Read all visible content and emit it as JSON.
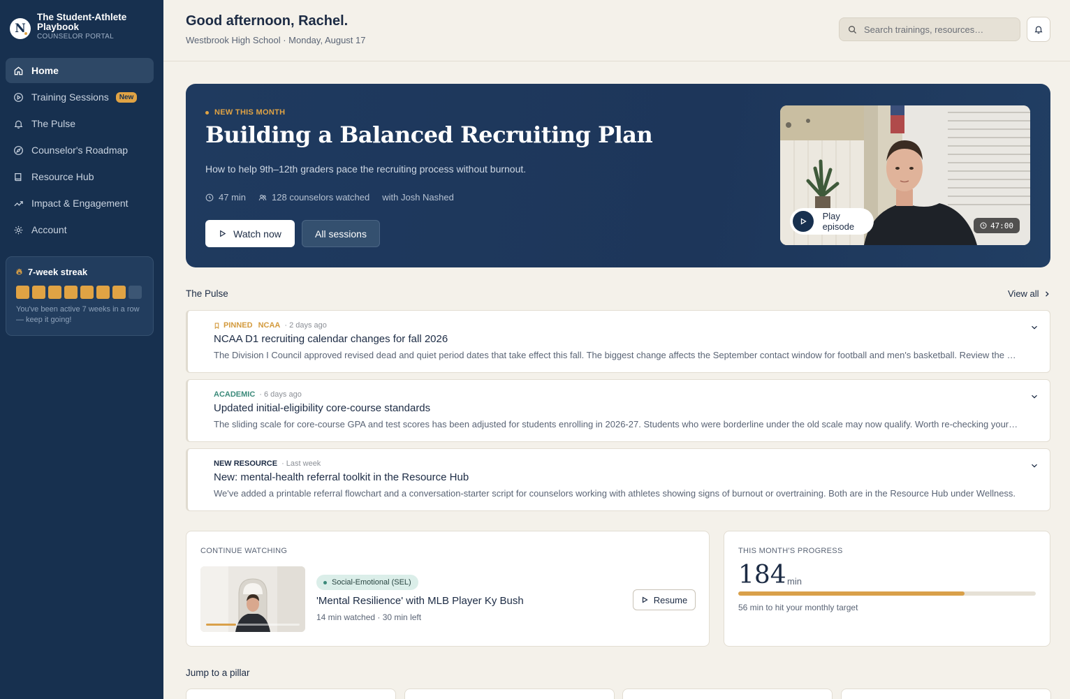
{
  "brand": {
    "logo_letter": "N",
    "title": "The Student-Athlete Playbook",
    "subtitle": "COUNSELOR PORTAL"
  },
  "nav": {
    "items": [
      {
        "label": "Home",
        "icon": "home-icon"
      },
      {
        "label": "Training Sessions",
        "icon": "play-circle-icon",
        "badge": "New"
      },
      {
        "label": "The Pulse",
        "icon": "bell-icon"
      },
      {
        "label": "Counselor's Roadmap",
        "icon": "compass-icon"
      },
      {
        "label": "Resource Hub",
        "icon": "book-icon"
      },
      {
        "label": "Impact & Engagement",
        "icon": "trending-up-icon"
      },
      {
        "label": "Account",
        "icon": "gear-icon"
      }
    ],
    "active": "Home"
  },
  "streak": {
    "title": "7-week streak",
    "weeks_active": 7,
    "weeks_total": 8,
    "message": "You've been active 7 weeks in a row — keep it going!"
  },
  "header": {
    "greeting": "Good afternoon, Rachel.",
    "subtitle": "Westbrook High School · Monday, August 17",
    "search_placeholder": "Search trainings, resources…"
  },
  "hero": {
    "tag": "NEW THIS MONTH",
    "title": "Building a Balanced Recruiting Plan",
    "description": "How to help 9th–12th graders pace the recruiting process without burnout.",
    "duration": "47 min",
    "watched": "128 counselors watched",
    "host": "with Josh Nashed",
    "watch_label": "Watch now",
    "all_label": "All sessions",
    "play_label": "Play episode",
    "video_duration": "47:00"
  },
  "pulse": {
    "title": "The Pulse",
    "view_all": "View all",
    "items": [
      {
        "pinned": "PINNED",
        "category": "NCAA",
        "category_color": "#d39a3d",
        "time": "· 2 days ago",
        "title": "NCAA D1 recruiting calendar changes for fall 2026",
        "body": "The Division I Council approved revised dead and quiet period dates that take effect this fall. The biggest change affects the September contact window for football and men's basketball. Review the new calendar before your fall advising meetings."
      },
      {
        "category": "ACADEMIC",
        "category_color": "#3b8a7a",
        "time": "· 6 days ago",
        "title": "Updated initial-eligibility core-course standards",
        "body": "The sliding scale for core-course GPA and test scores has been adjusted for students enrolling in 2026-27. Students who were borderline under the old scale may now qualify. Worth re-checking your junior class list."
      },
      {
        "category": "NEW RESOURCE",
        "category_color": "#1c2b44",
        "time": "· Last week",
        "title": "New: mental-health referral toolkit in the Resource Hub",
        "body": "We've added a printable referral flowchart and a conversation-starter script for counselors working with athletes showing signs of burnout or overtraining. Both are in the Resource Hub under Wellness."
      }
    ]
  },
  "continue_watching": {
    "label": "CONTINUE WATCHING",
    "tag": "Social-Emotional (SEL)",
    "title": "'Mental Resilience' with MLB Player Ky Bush",
    "sub": "14 min watched · 30 min left",
    "resume_label": "Resume",
    "progress_fraction": 0.32
  },
  "progress": {
    "label": "THIS MONTH'S PROGRESS",
    "minutes": "184",
    "unit": "min",
    "fraction": 0.76,
    "note": "56 min to hit your monthly target"
  },
  "pillars": {
    "title": "Jump to a pillar"
  }
}
